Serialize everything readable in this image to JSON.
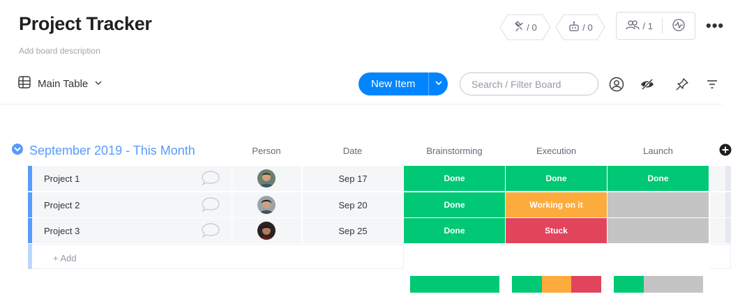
{
  "board": {
    "title": "Project Tracker",
    "description": "Add board description"
  },
  "header_actions": {
    "integrations_count": "/ 0",
    "automations_count": "/ 0",
    "members_count": "/ 1"
  },
  "toolbar": {
    "view_label": "Main Table",
    "new_item_label": "New Item",
    "search_placeholder": "Search / Filter Board"
  },
  "group": {
    "title": "September 2019 - This Month",
    "color": "#579bfc",
    "columns": [
      "Person",
      "Date",
      "Brainstorming",
      "Execution",
      "Launch"
    ],
    "add_row_label": "+ Add"
  },
  "rows": [
    {
      "name": "Project 1",
      "date": "Sep 17",
      "brainstorming": {
        "label": "Done",
        "color": "#00c875"
      },
      "execution": {
        "label": "Done",
        "color": "#00c875"
      },
      "launch": {
        "label": "Done",
        "color": "#00c875"
      }
    },
    {
      "name": "Project 2",
      "date": "Sep 20",
      "brainstorming": {
        "label": "Done",
        "color": "#00c875"
      },
      "execution": {
        "label": "Working on it",
        "color": "#fdab3d"
      },
      "launch": {
        "label": "",
        "color": "#c4c4c4"
      }
    },
    {
      "name": "Project 3",
      "date": "Sep 25",
      "brainstorming": {
        "label": "Done",
        "color": "#00c875"
      },
      "execution": {
        "label": "Stuck",
        "color": "#e2445c"
      },
      "launch": {
        "label": "",
        "color": "#c4c4c4"
      }
    }
  ],
  "colors": {
    "done": "#00c875",
    "working": "#fdab3d",
    "stuck": "#e2445c",
    "empty": "#c4c4c4",
    "primary": "#0085ff"
  }
}
